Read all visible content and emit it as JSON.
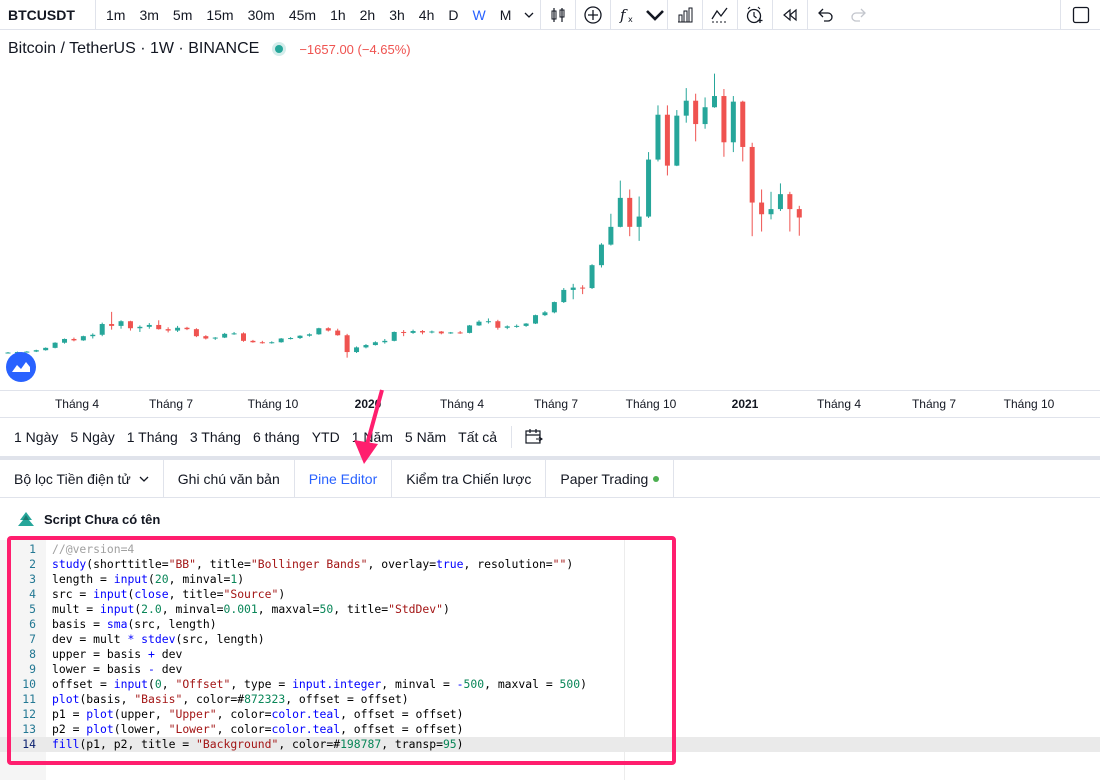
{
  "toolbar": {
    "symbol": "BTCUSDT",
    "intervals": [
      "1m",
      "3m",
      "5m",
      "15m",
      "30m",
      "45m",
      "1h",
      "2h",
      "3h",
      "4h",
      "D",
      "W",
      "M"
    ],
    "active_interval": "W"
  },
  "legend": {
    "title": "Bitcoin / TetherUS · 1W · BINANCE",
    "change": "−1657.00 (−4.65%)"
  },
  "colors": {
    "up": "#26a69a",
    "down": "#ef5350",
    "accent": "#2962ff",
    "highlight": "#ff1e6e"
  },
  "time_axis": [
    "Tháng 4",
    "Tháng 7",
    "Tháng 10",
    "2020",
    "Tháng 4",
    "Tháng 7",
    "Tháng 10",
    "2021",
    "Tháng 4",
    "Tháng 7",
    "Tháng 10"
  ],
  "ranges": [
    "1 Ngày",
    "5 Ngày",
    "1 Tháng",
    "3 Tháng",
    "6 tháng",
    "YTD",
    "1 Năm",
    "5 Năm",
    "Tất cả"
  ],
  "tabs": [
    {
      "label": "Bộ lọc Tiền điện tử"
    },
    {
      "label": "Ghi chú văn bản"
    },
    {
      "label": "Pine Editor"
    },
    {
      "label": "Kiểm tra Chiến lược"
    },
    {
      "label": "Paper Trading"
    }
  ],
  "script_title": "Script Chưa có tên",
  "code_lines": [
    "//@version=4",
    "study(shorttitle=\"BB\", title=\"Bollinger Bands\", overlay=true, resolution=\"\")",
    "length = input(20, minval=1)",
    "src = input(close, title=\"Source\")",
    "mult = input(2.0, minval=0.001, maxval=50, title=\"StdDev\")",
    "basis = sma(src, length)",
    "dev = mult * stdev(src, length)",
    "upper = basis + dev",
    "lower = basis - dev",
    "offset = input(0, \"Offset\", type = input.integer, minval = -500, maxval = 500)",
    "plot(basis, \"Basis\", color=#872323, offset = offset)",
    "p1 = plot(upper, \"Upper\", color=color.teal, offset = offset)",
    "p2 = plot(lower, \"Lower\", color=color.teal, offset = offset)",
    "fill(p1, p2, title = \"Background\", color=#198787, transp=95)"
  ],
  "chart_data": {
    "type": "candlestick",
    "timeframe": "1W",
    "series": [
      {
        "name": "BTCUSDT",
        "values": [
          [
            5000,
            5200,
            4900,
            5100
          ],
          [
            5100,
            5300,
            5000,
            5200
          ],
          [
            5200,
            5400,
            5100,
            5300
          ],
          [
            5300,
            5700,
            5200,
            5600
          ],
          [
            5600,
            6200,
            5500,
            6100
          ],
          [
            6100,
            7300,
            6000,
            7200
          ],
          [
            7200,
            8100,
            7000,
            8000
          ],
          [
            8000,
            8300,
            7500,
            7700
          ],
          [
            7700,
            8700,
            7600,
            8600
          ],
          [
            8600,
            9200,
            8100,
            8900
          ],
          [
            8900,
            11500,
            8600,
            11200
          ],
          [
            11200,
            13800,
            10000,
            10800
          ],
          [
            10800,
            12000,
            10200,
            11800
          ],
          [
            11800,
            11900,
            9800,
            10300
          ],
          [
            10300,
            10900,
            9500,
            10600
          ],
          [
            10600,
            11400,
            10200,
            11000
          ],
          [
            11000,
            12000,
            10000,
            10100
          ],
          [
            10100,
            10500,
            9400,
            9800
          ],
          [
            9800,
            10800,
            9500,
            10400
          ],
          [
            10400,
            10600,
            9900,
            10100
          ],
          [
            10100,
            10300,
            8400,
            8600
          ],
          [
            8600,
            8800,
            7900,
            8100
          ],
          [
            8100,
            8400,
            7800,
            8300
          ],
          [
            8300,
            9300,
            8200,
            9100
          ],
          [
            9100,
            9500,
            8900,
            9200
          ],
          [
            9200,
            9400,
            7400,
            7600
          ],
          [
            7600,
            7800,
            7200,
            7300
          ],
          [
            7300,
            7600,
            7000,
            7200
          ],
          [
            7200,
            7500,
            7000,
            7300
          ],
          [
            7300,
            8200,
            7200,
            8100
          ],
          [
            8100,
            8400,
            7900,
            8200
          ],
          [
            8200,
            8800,
            8000,
            8700
          ],
          [
            8700,
            9200,
            8500,
            9000
          ],
          [
            9000,
            10400,
            8900,
            10300
          ],
          [
            10300,
            10500,
            9600,
            9800
          ],
          [
            9800,
            10200,
            8700,
            8800
          ],
          [
            8800,
            9100,
            4000,
            5200
          ],
          [
            5200,
            6400,
            5000,
            6200
          ],
          [
            6200,
            6900,
            6000,
            6700
          ],
          [
            6700,
            7500,
            6600,
            7300
          ],
          [
            7300,
            8000,
            7000,
            7600
          ],
          [
            7600,
            9600,
            7500,
            9500
          ],
          [
            9500,
            9900,
            8600,
            9300
          ],
          [
            9300,
            10000,
            9100,
            9700
          ],
          [
            9700,
            9900,
            9000,
            9400
          ],
          [
            9400,
            9800,
            9200,
            9600
          ],
          [
            9600,
            9700,
            9000,
            9200
          ],
          [
            9200,
            9500,
            9100,
            9400
          ],
          [
            9400,
            9700,
            9100,
            9300
          ],
          [
            9300,
            11000,
            9200,
            10900
          ],
          [
            10900,
            12000,
            10800,
            11700
          ],
          [
            11700,
            12400,
            11300,
            11800
          ],
          [
            11800,
            12100,
            10000,
            10400
          ],
          [
            10400,
            10900,
            10100,
            10700
          ],
          [
            10700,
            11100,
            10400,
            10800
          ],
          [
            10800,
            11400,
            10600,
            11300
          ],
          [
            11300,
            13200,
            11200,
            13100
          ],
          [
            13100,
            14000,
            12900,
            13700
          ],
          [
            13700,
            16000,
            13500,
            15900
          ],
          [
            15900,
            18900,
            15700,
            18500
          ],
          [
            18500,
            19800,
            16500,
            19000
          ],
          [
            19000,
            19500,
            17600,
            18900
          ],
          [
            18900,
            24000,
            18700,
            23800
          ],
          [
            23800,
            28500,
            23300,
            28200
          ],
          [
            28200,
            34800,
            28000,
            32000
          ],
          [
            32000,
            41900,
            31900,
            38200
          ],
          [
            38200,
            40000,
            30000,
            32000
          ],
          [
            32000,
            38500,
            29000,
            34200
          ],
          [
            34200,
            48000,
            33900,
            46400
          ],
          [
            46400,
            58000,
            46000,
            56000
          ],
          [
            56000,
            58000,
            43000,
            45100
          ],
          [
            45100,
            57000,
            45000,
            55800
          ],
          [
            55800,
            61700,
            54300,
            59000
          ],
          [
            59000,
            60500,
            50300,
            54000
          ],
          [
            54000,
            59700,
            53000,
            57600
          ],
          [
            57600,
            64800,
            57500,
            60000
          ],
          [
            60000,
            61500,
            47000,
            50100
          ],
          [
            50100,
            60000,
            48000,
            58800
          ],
          [
            58800,
            59000,
            46000,
            49100
          ],
          [
            49100,
            50000,
            30000,
            37200
          ],
          [
            37200,
            40000,
            31000,
            34700
          ],
          [
            34700,
            39500,
            33600,
            35800
          ],
          [
            35800,
            41300,
            35400,
            39000
          ],
          [
            39000,
            39500,
            31000,
            35800
          ],
          [
            35800,
            36500,
            30100,
            34000
          ]
        ]
      }
    ]
  }
}
